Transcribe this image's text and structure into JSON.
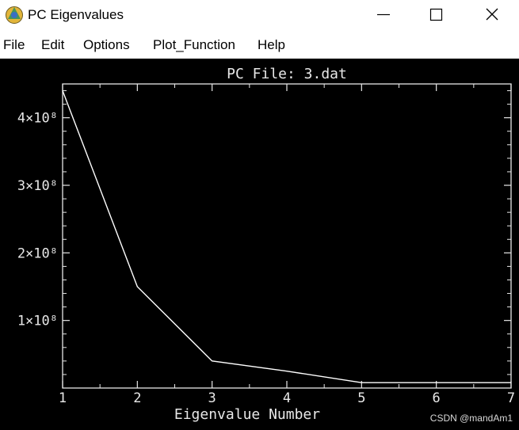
{
  "window": {
    "title": "PC Eigenvalues"
  },
  "menubar": {
    "items": [
      "File",
      "Edit",
      "Options",
      "Plot_Function",
      "Help"
    ]
  },
  "chart_data": {
    "type": "line",
    "title": "PC File: 3.dat",
    "xlabel": "Eigenvalue Number",
    "ylabel": "",
    "x": [
      1,
      2,
      3,
      4,
      5,
      6,
      7
    ],
    "y": [
      440000000,
      150000000,
      40000000,
      25000000,
      8000000,
      8000000,
      8000000
    ],
    "xlim": [
      1,
      7
    ],
    "ylim": [
      0,
      450000000
    ],
    "x_ticks": [
      "1",
      "2",
      "3",
      "4",
      "5",
      "6",
      "7"
    ],
    "y_ticks": [
      {
        "value": 100000000,
        "label": "1×10⁸"
      },
      {
        "value": 200000000,
        "label": "2×10⁸"
      },
      {
        "value": 300000000,
        "label": "3×10⁸"
      },
      {
        "value": 400000000,
        "label": "4×10⁸"
      }
    ],
    "grid": false,
    "colors": {
      "background": "#000000",
      "line": "#ffffff"
    }
  },
  "watermark": "CSDN @mandAm1"
}
